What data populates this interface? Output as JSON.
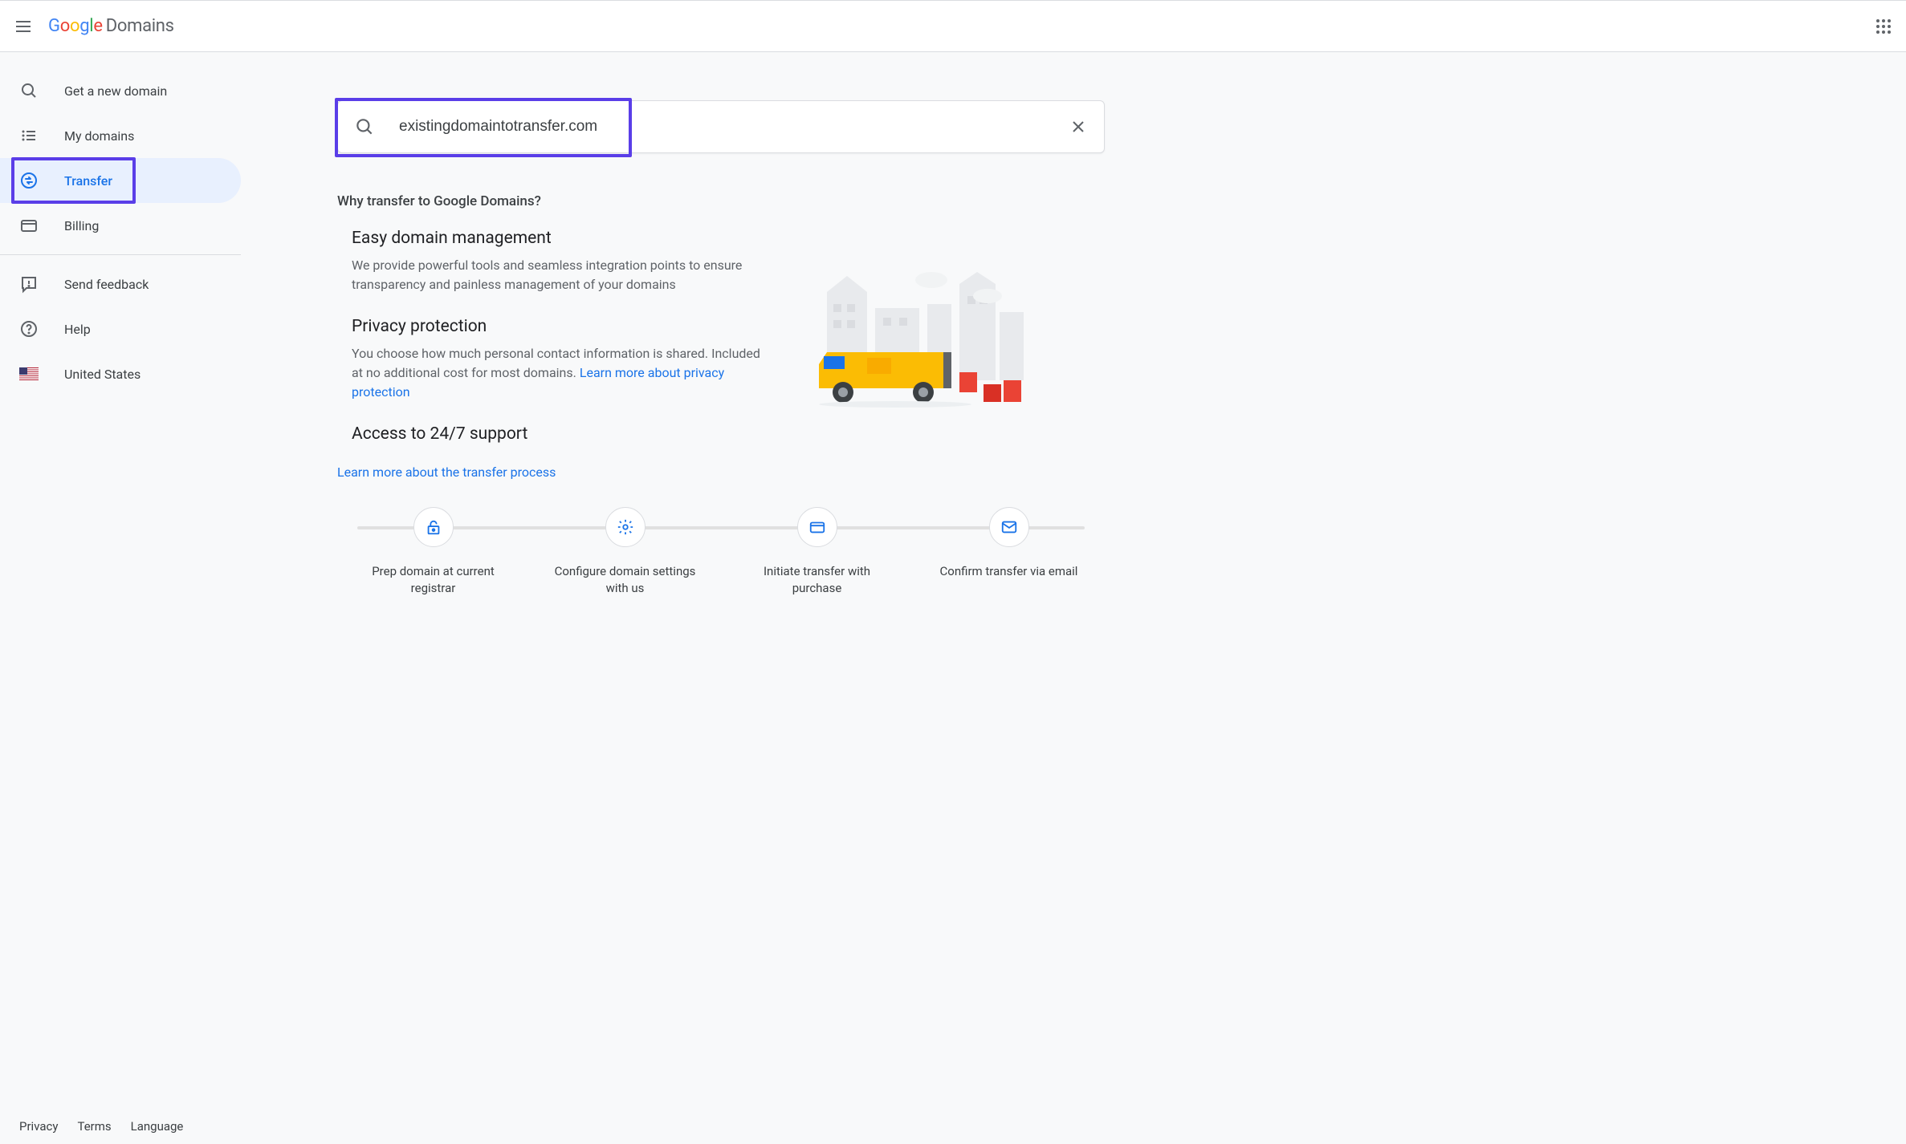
{
  "header": {
    "logo_text_google": "Google",
    "logo_text_rest": "Domains"
  },
  "sidebar": {
    "items": [
      {
        "label": "Get a new domain"
      },
      {
        "label": "My domains"
      },
      {
        "label": "Transfer"
      },
      {
        "label": "Billing"
      },
      {
        "label": "Send feedback"
      },
      {
        "label": "Help"
      },
      {
        "label": "United States"
      }
    ]
  },
  "search": {
    "value": "existingdomaintotransfer.com"
  },
  "main": {
    "section_title": "Why transfer to Google Domains?",
    "benefits": [
      {
        "title": "Easy domain management",
        "text": "We provide powerful tools and seamless integration points to ensure transparency and painless management of your domains"
      },
      {
        "title": "Privacy protection",
        "text": "You choose how much personal contact information is shared. Included at no additional cost for most domains. ",
        "link_text": "Learn more about privacy protection"
      },
      {
        "title": "Access to 24/7 support",
        "text": ""
      }
    ],
    "learn_link": "Learn more about the transfer process",
    "steps": [
      "Prep domain at current registrar",
      "Configure domain settings with us",
      "Initiate transfer with purchase",
      "Confirm transfer via email"
    ]
  },
  "footer": {
    "privacy": "Privacy",
    "terms": "Terms",
    "language": "Language"
  }
}
